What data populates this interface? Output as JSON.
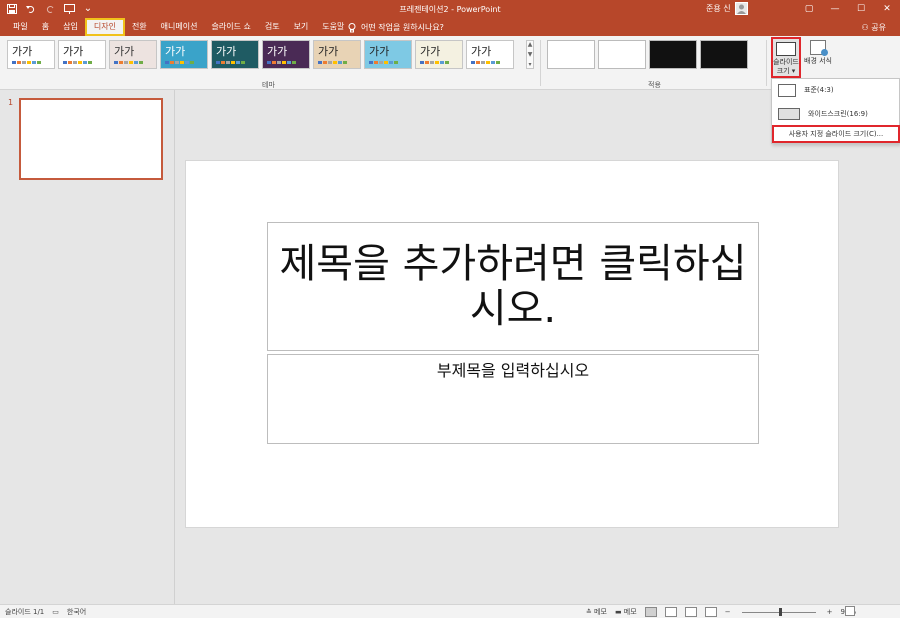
{
  "app": {
    "document_title": "프레젠테이션2",
    "separator": "-",
    "app_name": "PowerPoint",
    "user_name": "준용 신"
  },
  "qat": {
    "save_icon": "save-icon",
    "undo_icon": "undo-icon",
    "redo_icon": "redo-icon",
    "present_icon": "present-icon",
    "more_glyph": "⌄"
  },
  "window_controls": {
    "ribbon_display": "▢",
    "minimize": "—",
    "maximize": "☐",
    "close": "✕"
  },
  "tabs": [
    {
      "label": "파일"
    },
    {
      "label": "홈"
    },
    {
      "label": "삽입"
    },
    {
      "label": "디자인",
      "active": true
    },
    {
      "label": "전환"
    },
    {
      "label": "애니메이션"
    },
    {
      "label": "슬라이드 쇼"
    },
    {
      "label": "검토"
    },
    {
      "label": "보기"
    },
    {
      "label": "도움말"
    }
  ],
  "tell_me": {
    "icon": "lightbulb-icon",
    "text": "어떤 작업을 원하시나요?"
  },
  "share": {
    "label": "공유"
  },
  "ribbon": {
    "themes": [
      {
        "text": "가가",
        "bg": "#ffffff",
        "fg": "#222222"
      },
      {
        "text": "가가",
        "bg": "#ffffff",
        "fg": "#222222"
      },
      {
        "text": "가가",
        "bg": "#ede3e0",
        "fg": "#333333"
      },
      {
        "text": "가가",
        "bg": "#3aa3c9",
        "fg": "#ffffff"
      },
      {
        "text": "가가",
        "bg": "#1f5b63",
        "fg": "#ffffff"
      },
      {
        "text": "가가",
        "bg": "#4a2a55",
        "fg": "#ffffff"
      },
      {
        "text": "가가",
        "bg": "#e8d3b5",
        "fg": "#222222"
      },
      {
        "text": "가가",
        "bg": "#7ec9e4",
        "fg": "#222222"
      },
      {
        "text": "가가",
        "bg": "#f4f1e1",
        "fg": "#222222"
      },
      {
        "text": "가가",
        "bg": "#ffffff",
        "fg": "#222222"
      }
    ],
    "themes_group_label": "테마",
    "variants": [
      {
        "bg": "#ffffff"
      },
      {
        "bg": "#ffffff"
      },
      {
        "bg": "#111111"
      },
      {
        "bg": "#111111"
      }
    ],
    "variants_group_label": "적용",
    "slide_size_label": "슬라이드 크기 ▾",
    "format_background_label": "배경 서식"
  },
  "slide_size_menu": {
    "standard": "표준(4:3)",
    "widescreen": "와이드스크린(16:9)",
    "custom": "사용자 지정 슬라이드 크기(C)..."
  },
  "thumbnails": [
    {
      "number": "1"
    }
  ],
  "slide": {
    "title_placeholder": "제목을 추가하려면 클릭하십시오.",
    "subtitle_placeholder": "부제목을 입력하십시오"
  },
  "status": {
    "slide_info": "슬라이드 1/1",
    "language": "한국어",
    "notes_label": "메모",
    "comments_label": "메모",
    "zoom_minus": "−",
    "zoom_plus": "+",
    "zoom_percent": "92%"
  },
  "colors": {
    "accent": "#b7472a",
    "highlight": "#e0262c",
    "active_tab_border": "#f1c21b"
  }
}
